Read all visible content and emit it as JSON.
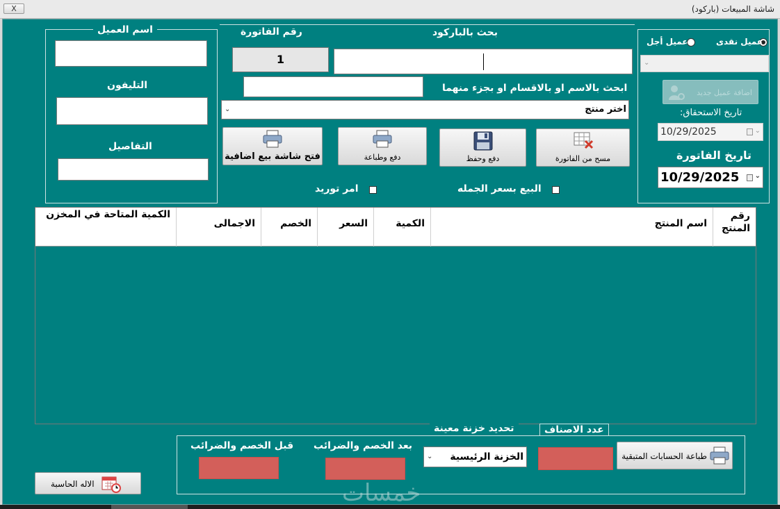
{
  "window": {
    "title": "شاشة المبيعات (باركود)",
    "close_label": "X"
  },
  "customer": {
    "legend": "اسم العميل",
    "phone_label": "التليفون",
    "details_label": "التفاصيل",
    "name_value": "",
    "phone_value": "",
    "details_value": ""
  },
  "invoice": {
    "number_label": "رقم الفاتورة",
    "number_value": "1"
  },
  "search": {
    "barcode_label": "بحث بالباركود",
    "barcode_value": "",
    "name_label": "ابحث بالاسم او بالاقسام او بجزء منهما",
    "name_value": "",
    "product_select": "اختر منتج"
  },
  "payment": {
    "cash_label": "عميل نقدى",
    "credit_label": "عميل أجل",
    "selected": "cash",
    "add_customer_label": "اضافة عميل جديد",
    "due_date_label": "تاريخ الاستحقاق:",
    "due_date_value": "10/29/2025",
    "invoice_date_label": "تاريخ الفاتورة",
    "invoice_date_value": "10/29/2025"
  },
  "actions": {
    "clear_invoice": "مسح من الفاتورة",
    "pay_save": "دفع وحفظ",
    "pay_print": "دفع وطباعة",
    "open_screen": "فتح شاشة بيع اضافية"
  },
  "options": {
    "wholesale_label": "البيع بسعر الجمله",
    "supply_order_label": "امر توريد",
    "wholesale_checked": false,
    "supply_checked": false
  },
  "table": {
    "columns": [
      "رقم المنتج",
      "اسم المنتج",
      "الكمية",
      "السعر",
      "الخصم",
      "الاجمالى",
      "الكمية المتاحة في المخزن"
    ],
    "rows": []
  },
  "totals": {
    "before_label": "قبل الخصم والضرائب",
    "after_label": "بعد الخصم والضرائب",
    "store_label": "تحديد خزنة معينة",
    "store_value": "الخزنة الرئيسية",
    "items_count_label": "عدد الاصناف",
    "print_accounts_label": "طباعة الحسابات المتبقية"
  },
  "calculator_label": "الاله الحاسبة",
  "watermark": "خمسات",
  "colors": {
    "background": "#008080",
    "total_box": "#d35f5a"
  }
}
